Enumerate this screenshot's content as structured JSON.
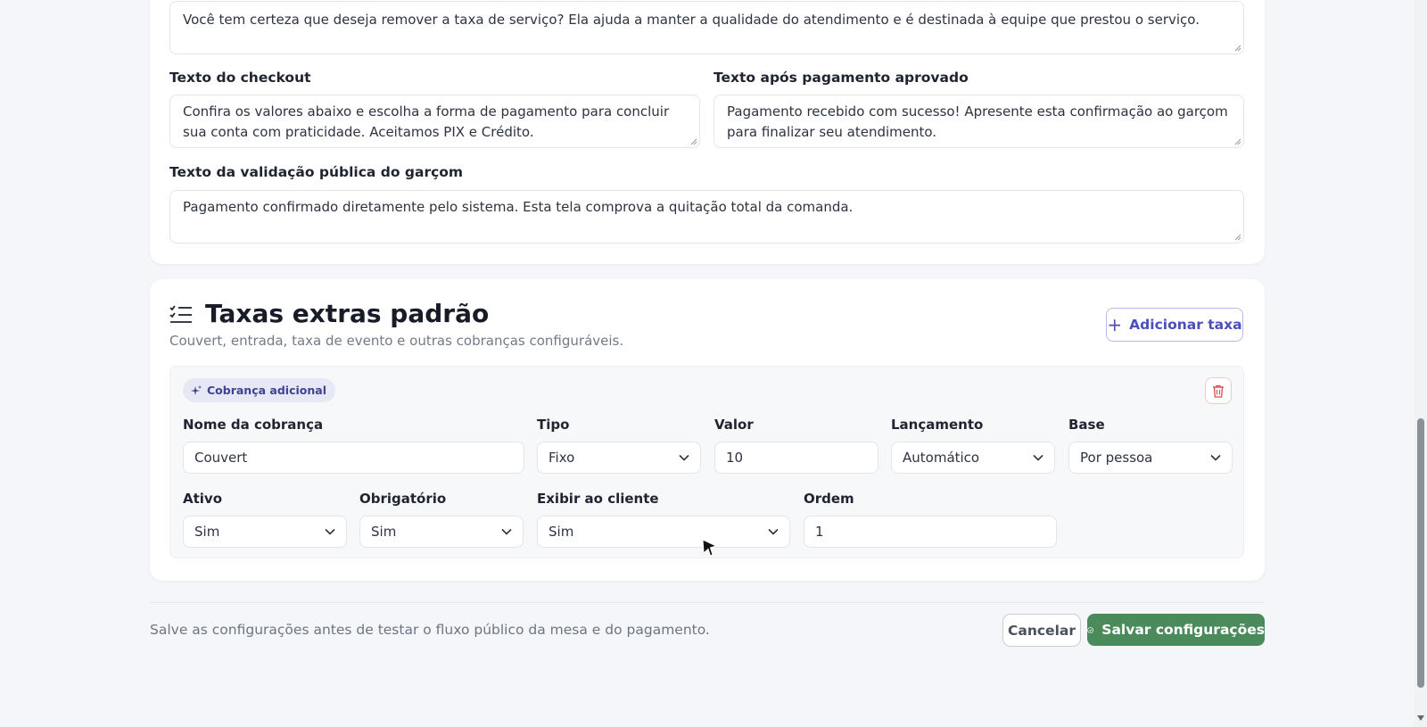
{
  "messages": {
    "service_fee_removal_text": "Você tem certeza que deseja remover a taxa de serviço? Ela ajuda a manter a qualidade do atendimento e é destinada à equipe que prestou o serviço.",
    "checkout_label": "Texto do checkout",
    "checkout_text": "Confira os valores abaixo e escolha a forma de pagamento para concluir sua conta com praticidade. Aceitamos PIX e Crédito.",
    "after_payment_label": "Texto após pagamento aprovado",
    "after_payment_text": "Pagamento recebido com sucesso! Apresente esta confirmação ao garçom para finalizar seu atendimento.",
    "waiter_validation_label": "Texto da validação pública do garçom",
    "waiter_validation_text": "Pagamento confirmado diretamente pelo sistema. Esta tela comprova a quitação total da comanda."
  },
  "extra_fees": {
    "title": "Taxas extras padrão",
    "subtitle": "Couvert, entrada, taxa de evento e outras cobranças configuráveis.",
    "add_button": "Adicionar taxa",
    "item": {
      "badge": "Cobrança adicional",
      "fields": {
        "name_label": "Nome da cobrança",
        "name_value": "Couvert",
        "type_label": "Tipo",
        "type_value": "Fixo",
        "value_label": "Valor",
        "value_value": "10",
        "launch_label": "Lançamento",
        "launch_value": "Automático",
        "base_label": "Base",
        "base_value": "Por pessoa",
        "active_label": "Ativo",
        "active_value": "Sim",
        "required_label": "Obrigatório",
        "required_value": "Sim",
        "show_label": "Exibir ao cliente",
        "show_value": "Sim",
        "order_label": "Ordem",
        "order_value": "1"
      }
    }
  },
  "footer": {
    "note": "Salve as configurações antes de testar o fluxo público da mesa e do pagamento.",
    "cancel": "Cancelar",
    "save": "Salvar configurações"
  },
  "colors": {
    "accent": "#4b4fb8",
    "save_green": "#4b8a5a",
    "danger": "#d05050",
    "background": "#f5f6f9"
  },
  "icons": {
    "section": "list-checks-icon",
    "add": "plus-icon",
    "badge": "sparkles-icon",
    "delete": "trash-icon",
    "dropdown": "chevron-down-icon",
    "save": "check-circle-icon"
  }
}
